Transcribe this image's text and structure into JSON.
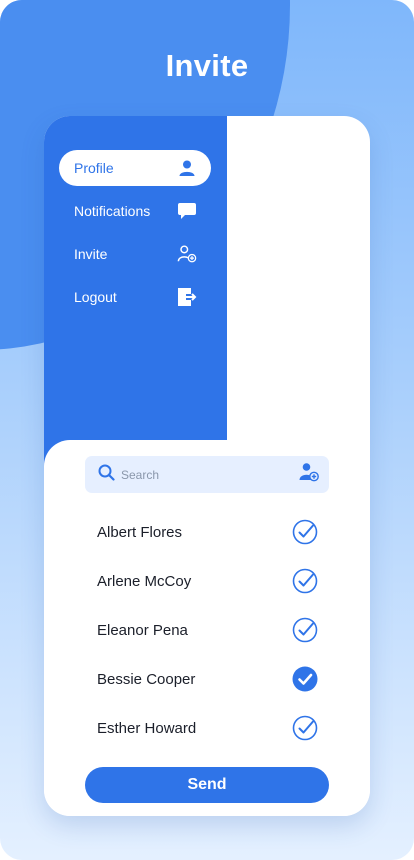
{
  "header": {
    "title": "Invite"
  },
  "menu": {
    "items": [
      {
        "label": "Profile",
        "icon": "user-icon",
        "active": true
      },
      {
        "label": "Notifications",
        "icon": "chat-bubble-icon",
        "active": false
      },
      {
        "label": "Invite",
        "icon": "add-user-icon",
        "active": false
      },
      {
        "label": "Logout",
        "icon": "logout-icon",
        "active": false
      }
    ]
  },
  "search": {
    "placeholder": "Search",
    "value": ""
  },
  "contacts": [
    {
      "name": "Albert Flores",
      "selected": false
    },
    {
      "name": "Arlene McCoy",
      "selected": false
    },
    {
      "name": "Eleanor Pena",
      "selected": false
    },
    {
      "name": "Bessie Cooper",
      "selected": true
    },
    {
      "name": "Esther Howard",
      "selected": false
    }
  ],
  "actions": {
    "send_label": "Send"
  },
  "colors": {
    "primary": "#2f74e8",
    "background_top": "#7fb7fb",
    "background_bottom": "#e4f0ff",
    "search_bg": "#e6efff"
  }
}
